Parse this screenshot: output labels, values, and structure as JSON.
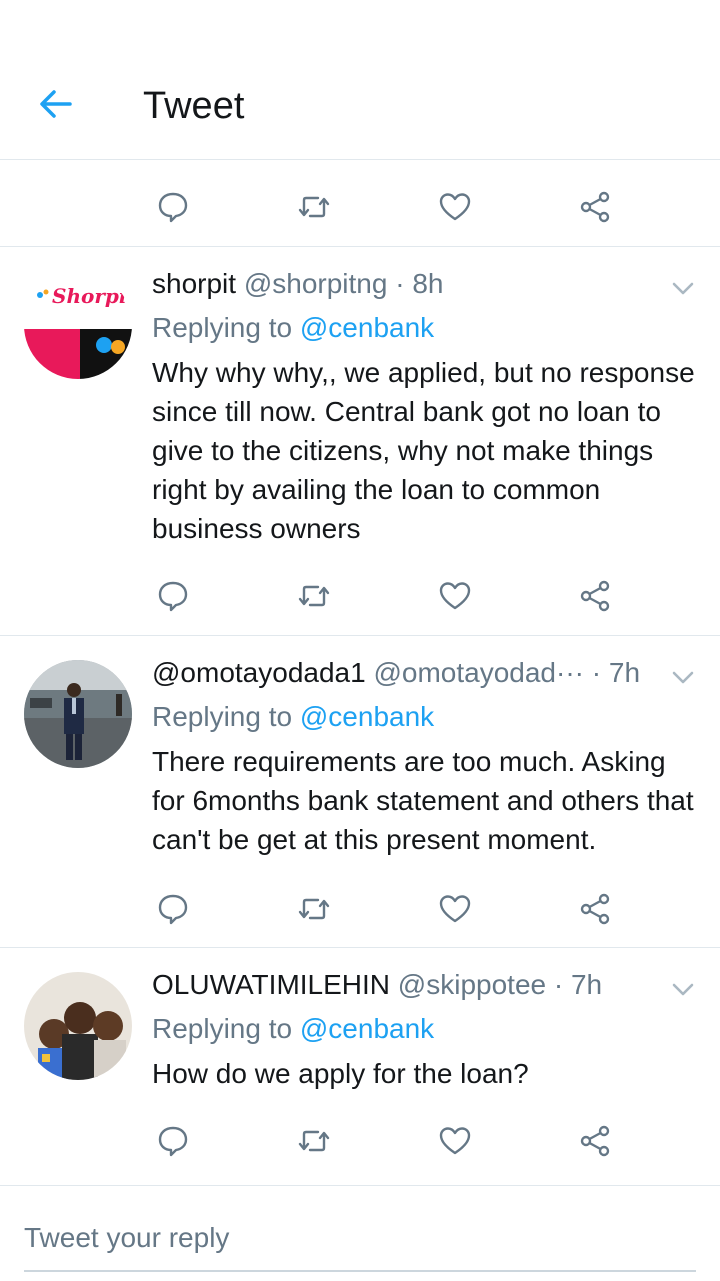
{
  "header": {
    "title": "Tweet"
  },
  "reply_box": {
    "placeholder": "Tweet your reply"
  },
  "tweets": [
    {
      "name": "shorpit",
      "handle": "@shorpitng",
      "time": "· 8h",
      "replying_prefix": "Replying to",
      "replying_to": "@cenbank",
      "text": "Why why why,, we applied, but no response since till now. Central bank got no loan to give to the citizens, why not make things right by availing the loan to common business owners",
      "avatar_logo_text": "Shorpit"
    },
    {
      "name": "@omotayodada1",
      "handle": "@omotayodad···",
      "time": "· 7h",
      "replying_prefix": "Replying to",
      "replying_to": "@cenbank",
      "text": "There requirements are too much. Asking for 6months bank statement and others that can't be get at this present moment."
    },
    {
      "name": "OLUWATIMILEHIN",
      "handle": "@skippotee",
      "time": "· 7h",
      "replying_prefix": "Replying to",
      "replying_to": "@cenbank",
      "text": "How do we apply for the loan?"
    }
  ],
  "icons": {
    "back": "arrow-left-icon",
    "reply": "speech-bubble-icon",
    "retweet": "retweet-icon",
    "like": "heart-icon",
    "share": "share-icon",
    "chevron": "chevron-down-icon"
  },
  "colors": {
    "accent": "#1da1f2",
    "icon_gray": "#657786",
    "divider": "#e1e8ed",
    "text": "#14171a"
  }
}
